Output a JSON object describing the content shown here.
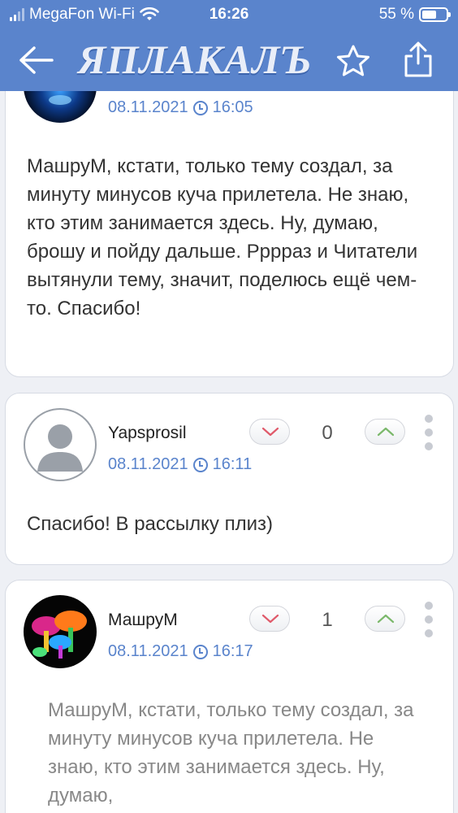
{
  "status_bar": {
    "carrier": "MegaFon Wi-Fi",
    "time": "16:26",
    "battery": "55 %"
  },
  "header": {
    "logo": "ЯПЛАКАЛЪ",
    "icons": [
      "back-arrow-icon",
      "star-icon",
      "share-icon"
    ]
  },
  "colors": {
    "accent": "#5a84cc",
    "downvote": "#e05a6a",
    "upvote": "#7bb86b"
  },
  "posts": [
    {
      "date": "08.11.2021",
      "time": "16:05",
      "text": "МашруМ, кстати, только тему создал,  за минуту минусов куча прилетела. Не знаю, кто этим занимается здесь. Ну, думаю, брошу и пойду дальше. Рррраз и Читатели вытянули тему, значит, поделюсь ещё чем-то. Спасибо!"
    },
    {
      "username": "Yapsprosil",
      "date": "08.11.2021",
      "time": "16:11",
      "rating": "0",
      "text": "Спасибо! В рассылку плиз)"
    },
    {
      "username": "МашруМ",
      "date": "08.11.2021",
      "time": "16:17",
      "rating": "1",
      "text": "МашруМ, кстати, только тему создал,  за минуту минусов куча прилетела. Не знаю, кто этим занимается здесь. Ну, думаю,"
    }
  ]
}
